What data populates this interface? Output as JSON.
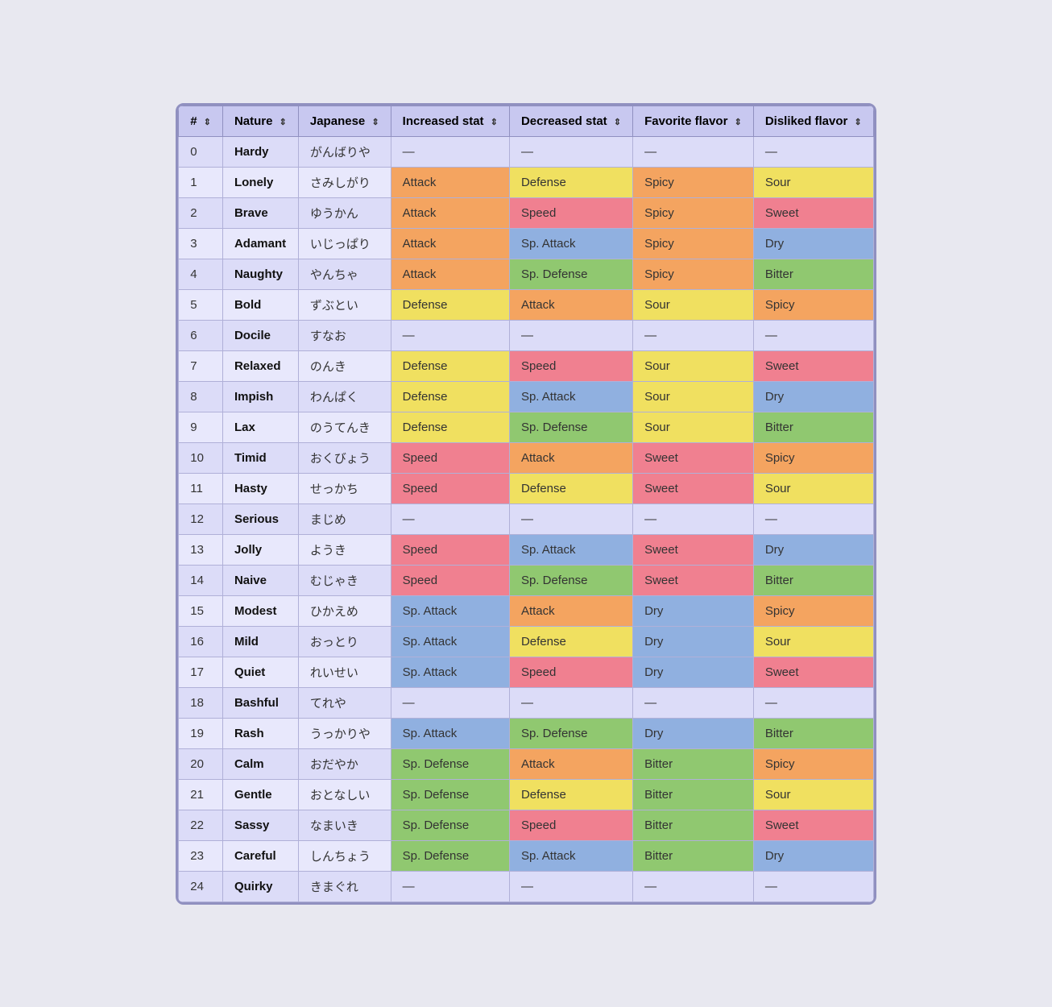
{
  "headers": [
    {
      "label": "#",
      "sort": true
    },
    {
      "label": "Nature",
      "sort": true
    },
    {
      "label": "Japanese",
      "sort": true
    },
    {
      "label": "Increased stat",
      "sort": true
    },
    {
      "label": "Decreased stat",
      "sort": true
    },
    {
      "label": "Favorite flavor",
      "sort": true
    },
    {
      "label": "Disliked flavor",
      "sort": true
    }
  ],
  "rows": [
    {
      "id": "0",
      "name": "Hardy",
      "japanese": "がんばりや",
      "inc": "—",
      "inc_class": "",
      "dec": "—",
      "dec_class": "",
      "fav": "—",
      "fav_class": "",
      "dis": "—",
      "dis_class": ""
    },
    {
      "id": "1",
      "name": "Lonely",
      "japanese": "さみしがり",
      "inc": "Attack",
      "inc_class": "stat-attack",
      "dec": "Defense",
      "dec_class": "stat-defense",
      "fav": "Spicy",
      "fav_class": "spicy",
      "dis": "Sour",
      "dis_class": "sour"
    },
    {
      "id": "2",
      "name": "Brave",
      "japanese": "ゆうかん",
      "inc": "Attack",
      "inc_class": "stat-attack",
      "dec": "Speed",
      "dec_class": "stat-speed",
      "fav": "Spicy",
      "fav_class": "spicy",
      "dis": "Sweet",
      "dis_class": "sweet"
    },
    {
      "id": "3",
      "name": "Adamant",
      "japanese": "いじっぱり",
      "inc": "Attack",
      "inc_class": "stat-attack",
      "dec": "Sp. Attack",
      "dec_class": "stat-sp-attack",
      "fav": "Spicy",
      "fav_class": "spicy",
      "dis": "Dry",
      "dis_class": "dry"
    },
    {
      "id": "4",
      "name": "Naughty",
      "japanese": "やんちゃ",
      "inc": "Attack",
      "inc_class": "stat-attack",
      "dec": "Sp. Defense",
      "dec_class": "stat-sp-defense",
      "fav": "Spicy",
      "fav_class": "spicy",
      "dis": "Bitter",
      "dis_class": "bitter"
    },
    {
      "id": "5",
      "name": "Bold",
      "japanese": "ずぶとい",
      "inc": "Defense",
      "inc_class": "stat-defense",
      "dec": "Attack",
      "dec_class": "stat-attack",
      "fav": "Sour",
      "fav_class": "sour",
      "dis": "Spicy",
      "dis_class": "spicy"
    },
    {
      "id": "6",
      "name": "Docile",
      "japanese": "すなお",
      "inc": "—",
      "inc_class": "",
      "dec": "—",
      "dec_class": "",
      "fav": "—",
      "fav_class": "",
      "dis": "—",
      "dis_class": ""
    },
    {
      "id": "7",
      "name": "Relaxed",
      "japanese": "のんき",
      "inc": "Defense",
      "inc_class": "stat-defense",
      "dec": "Speed",
      "dec_class": "stat-speed",
      "fav": "Sour",
      "fav_class": "sour",
      "dis": "Sweet",
      "dis_class": "sweet"
    },
    {
      "id": "8",
      "name": "Impish",
      "japanese": "わんぱく",
      "inc": "Defense",
      "inc_class": "stat-defense",
      "dec": "Sp. Attack",
      "dec_class": "stat-sp-attack",
      "fav": "Sour",
      "fav_class": "sour",
      "dis": "Dry",
      "dis_class": "dry"
    },
    {
      "id": "9",
      "name": "Lax",
      "japanese": "のうてんき",
      "inc": "Defense",
      "inc_class": "stat-defense",
      "dec": "Sp. Defense",
      "dec_class": "stat-sp-defense",
      "fav": "Sour",
      "fav_class": "sour",
      "dis": "Bitter",
      "dis_class": "bitter"
    },
    {
      "id": "10",
      "name": "Timid",
      "japanese": "おくびょう",
      "inc": "Speed",
      "inc_class": "stat-speed",
      "dec": "Attack",
      "dec_class": "stat-attack",
      "fav": "Sweet",
      "fav_class": "sweet",
      "dis": "Spicy",
      "dis_class": "spicy"
    },
    {
      "id": "11",
      "name": "Hasty",
      "japanese": "せっかち",
      "inc": "Speed",
      "inc_class": "stat-speed",
      "dec": "Defense",
      "dec_class": "stat-defense",
      "fav": "Sweet",
      "fav_class": "sweet",
      "dis": "Sour",
      "dis_class": "sour"
    },
    {
      "id": "12",
      "name": "Serious",
      "japanese": "まじめ",
      "inc": "—",
      "inc_class": "",
      "dec": "—",
      "dec_class": "",
      "fav": "—",
      "fav_class": "",
      "dis": "—",
      "dis_class": ""
    },
    {
      "id": "13",
      "name": "Jolly",
      "japanese": "ようき",
      "inc": "Speed",
      "inc_class": "stat-speed",
      "dec": "Sp. Attack",
      "dec_class": "stat-sp-attack",
      "fav": "Sweet",
      "fav_class": "sweet",
      "dis": "Dry",
      "dis_class": "dry"
    },
    {
      "id": "14",
      "name": "Naive",
      "japanese": "むじゃき",
      "inc": "Speed",
      "inc_class": "stat-speed",
      "dec": "Sp. Defense",
      "dec_class": "stat-sp-defense",
      "fav": "Sweet",
      "fav_class": "sweet",
      "dis": "Bitter",
      "dis_class": "bitter"
    },
    {
      "id": "15",
      "name": "Modest",
      "japanese": "ひかえめ",
      "inc": "Sp. Attack",
      "inc_class": "stat-sp-attack",
      "dec": "Attack",
      "dec_class": "stat-attack",
      "fav": "Dry",
      "fav_class": "dry",
      "dis": "Spicy",
      "dis_class": "spicy"
    },
    {
      "id": "16",
      "name": "Mild",
      "japanese": "おっとり",
      "inc": "Sp. Attack",
      "inc_class": "stat-sp-attack",
      "dec": "Defense",
      "dec_class": "stat-defense",
      "fav": "Dry",
      "fav_class": "dry",
      "dis": "Sour",
      "dis_class": "sour"
    },
    {
      "id": "17",
      "name": "Quiet",
      "japanese": "れいせい",
      "inc": "Sp. Attack",
      "inc_class": "stat-sp-attack",
      "dec": "Speed",
      "dec_class": "stat-speed",
      "fav": "Dry",
      "fav_class": "dry",
      "dis": "Sweet",
      "dis_class": "sweet"
    },
    {
      "id": "18",
      "name": "Bashful",
      "japanese": "てれや",
      "inc": "—",
      "inc_class": "",
      "dec": "—",
      "dec_class": "",
      "fav": "—",
      "fav_class": "",
      "dis": "—",
      "dis_class": ""
    },
    {
      "id": "19",
      "name": "Rash",
      "japanese": "うっかりや",
      "inc": "Sp. Attack",
      "inc_class": "stat-sp-attack",
      "dec": "Sp. Defense",
      "dec_class": "stat-sp-defense",
      "fav": "Dry",
      "fav_class": "dry",
      "dis": "Bitter",
      "dis_class": "bitter"
    },
    {
      "id": "20",
      "name": "Calm",
      "japanese": "おだやか",
      "inc": "Sp. Defense",
      "inc_class": "stat-sp-defense",
      "dec": "Attack",
      "dec_class": "stat-attack",
      "fav": "Bitter",
      "fav_class": "bitter",
      "dis": "Spicy",
      "dis_class": "spicy"
    },
    {
      "id": "21",
      "name": "Gentle",
      "japanese": "おとなしい",
      "inc": "Sp. Defense",
      "inc_class": "stat-sp-defense",
      "dec": "Defense",
      "dec_class": "stat-defense",
      "fav": "Bitter",
      "fav_class": "bitter",
      "dis": "Sour",
      "dis_class": "sour"
    },
    {
      "id": "22",
      "name": "Sassy",
      "japanese": "なまいき",
      "inc": "Sp. Defense",
      "inc_class": "stat-sp-defense",
      "dec": "Speed",
      "dec_class": "stat-speed",
      "fav": "Bitter",
      "fav_class": "bitter",
      "dis": "Sweet",
      "dis_class": "sweet"
    },
    {
      "id": "23",
      "name": "Careful",
      "japanese": "しんちょう",
      "inc": "Sp. Defense",
      "inc_class": "stat-sp-defense",
      "dec": "Sp. Attack",
      "dec_class": "stat-sp-attack",
      "fav": "Bitter",
      "fav_class": "bitter",
      "dis": "Dry",
      "dis_class": "dry"
    },
    {
      "id": "24",
      "name": "Quirky",
      "japanese": "きまぐれ",
      "inc": "—",
      "inc_class": "",
      "dec": "—",
      "dec_class": "",
      "fav": "—",
      "fav_class": "",
      "dis": "—",
      "dis_class": ""
    }
  ]
}
